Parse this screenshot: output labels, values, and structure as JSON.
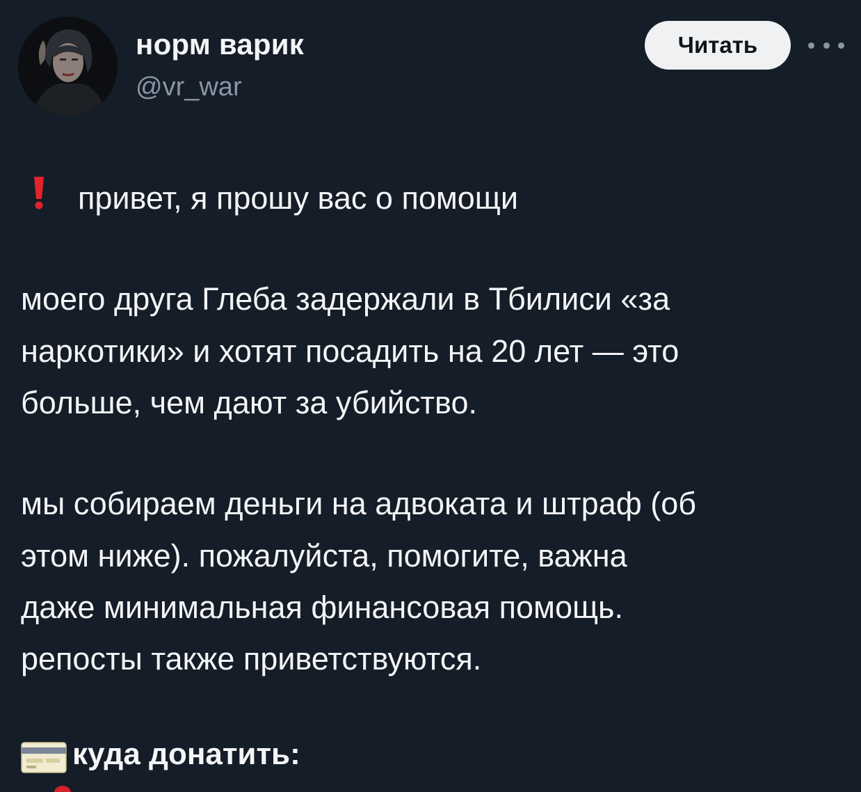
{
  "author": {
    "display_name": "норм варик",
    "handle": "@vr_war"
  },
  "actions": {
    "follow_label": "Читать",
    "more_icon": "more-horizontal-icon"
  },
  "post": {
    "lines": [
      "привет, я прошу вас о помощи",
      "моего друга Глеба задержали в Тбилиси «за",
      "наркотики» и хотят посадить на 20 лет — это",
      "больше, чем дают за убийство.",
      "мы собираем деньги на адвоката и штраф (об",
      "этом ниже). пожалуйста, помогите, важна",
      "даже минимальная финансовая помощь.",
      "репосты также приветствуются."
    ],
    "donate_heading": "куда донатить:",
    "icons": {
      "alert": "red-exclamation-icon",
      "card": "credit-card-icon"
    }
  },
  "colors": {
    "background": "#151d28",
    "text": "#f3f4f6",
    "secondary_text": "#8a96a3",
    "button_bg": "#eff1f3",
    "alert_red": "#e0242a"
  }
}
